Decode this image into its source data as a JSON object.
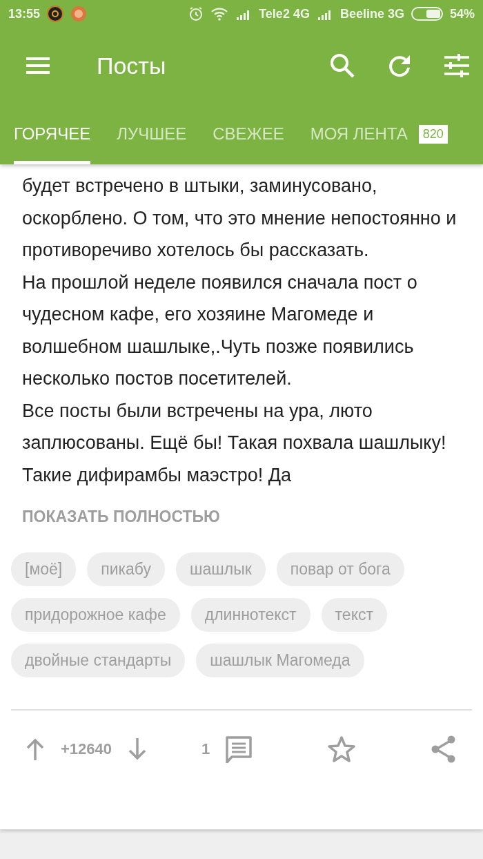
{
  "status_bar": {
    "time": "13:55",
    "carrier_1": "Tele2 4G",
    "carrier_2": "Beeline 3G",
    "battery": "54%"
  },
  "toolbar": {
    "title": "Посты"
  },
  "tabs": [
    {
      "label": "ГОРЯЧЕЕ",
      "selected": true
    },
    {
      "label": "ЛУЧШЕЕ",
      "selected": false
    },
    {
      "label": "СВЕЖЕЕ",
      "selected": false
    },
    {
      "label": "МОЯ ЛЕНТА",
      "selected": false,
      "badge": "820"
    }
  ],
  "post": {
    "paragraphs": [
      "будет встречено в штыки, заминусовано, оскорблено. О том, что это мнение непостоянно и противоречиво хотелось бы рассказать.",
      "На прошлой неделе появился сначала пост о чудесном кафе, его хозяине Магомеде и волшебном шашлыке,.Чуть позже появились несколько постов посетителей.",
      "Все посты были встречены на ура, люто заплюсованы. Ещё бы! Такая похвала шашлыку! Такие дифирамбы маэстро! Да"
    ],
    "show_more": "ПОКАЗАТЬ ПОЛНОСТЬЮ",
    "tags": [
      "[моё]",
      "пикабу",
      "шашлык",
      "повар от бога",
      "придорожное кафе",
      "длиннотекст",
      "текст",
      "двойные стандарты",
      "шашлык Магомеда"
    ],
    "rating": "+12640",
    "comments": "1"
  }
}
